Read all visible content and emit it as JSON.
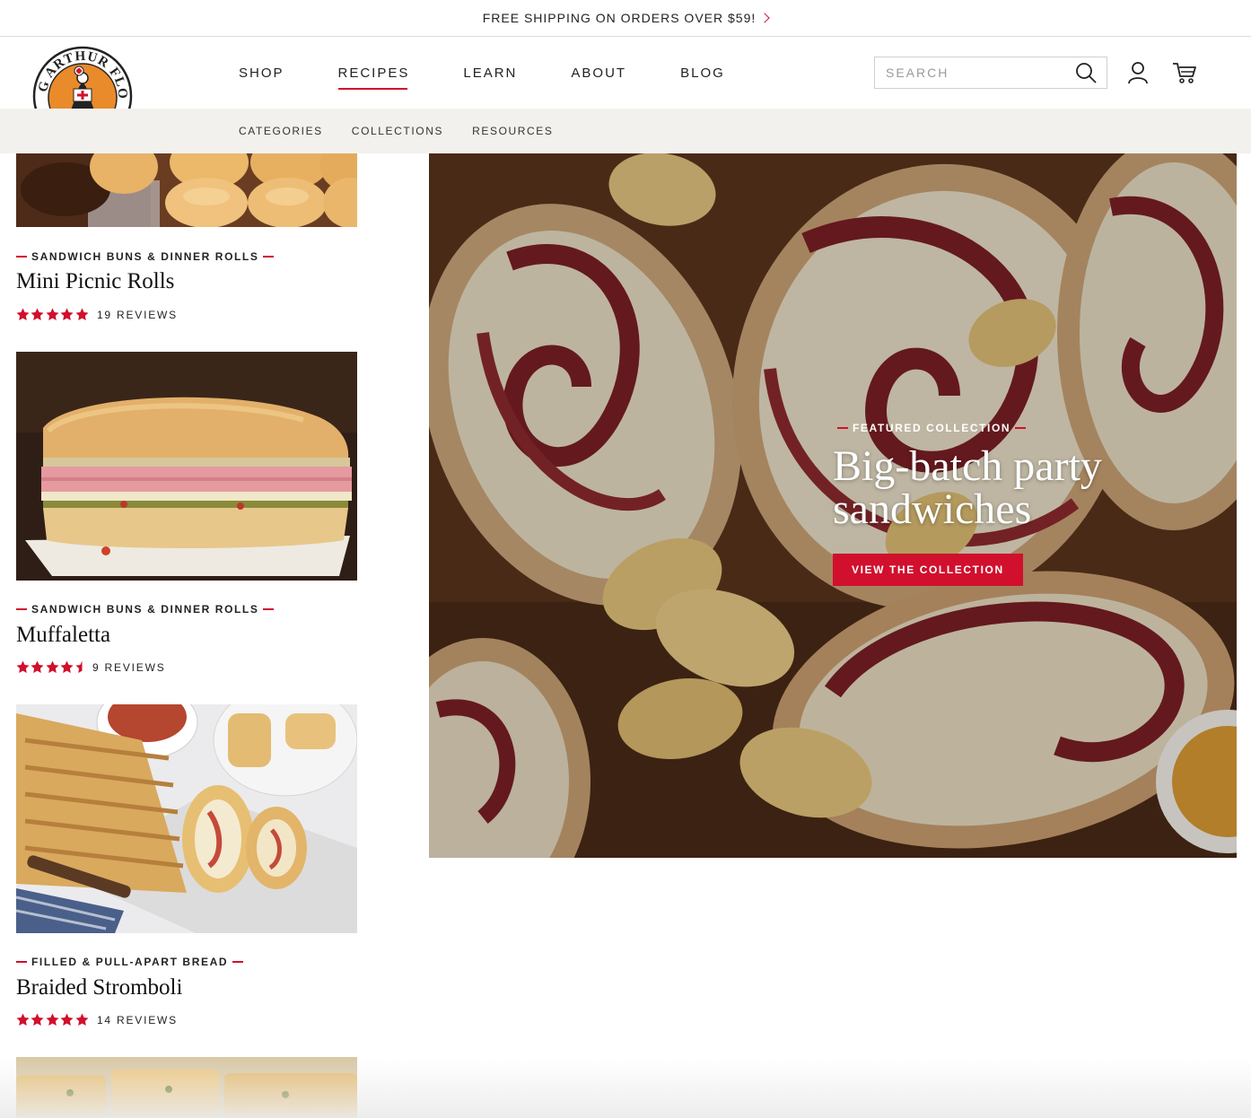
{
  "announcement": {
    "text": "FREE SHIPPING ON ORDERS OVER $59!"
  },
  "brand": {
    "logo_text": "KING ARTHUR FLOUR",
    "accent": "#d1102d"
  },
  "nav": {
    "items": [
      {
        "label": "SHOP",
        "active": false
      },
      {
        "label": "RECIPES",
        "active": true
      },
      {
        "label": "LEARN",
        "active": false
      },
      {
        "label": "ABOUT",
        "active": false
      },
      {
        "label": "BLOG",
        "active": false
      }
    ]
  },
  "search": {
    "placeholder": "SEARCH"
  },
  "subnav": {
    "items": [
      "CATEGORIES",
      "COLLECTIONS",
      "RESOURCES"
    ]
  },
  "cards": [
    {
      "category": "SANDWICH BUNS & DINNER ROLLS",
      "title": "Mini Picnic Rolls",
      "rating": 5,
      "reviews": "19 REVIEWS"
    },
    {
      "category": "SANDWICH BUNS & DINNER ROLLS",
      "title": "Muffaletta",
      "rating": 4.5,
      "reviews": "9 REVIEWS"
    },
    {
      "category": "FILLED & PULL-APART BREAD",
      "title": "Braided Stromboli",
      "rating": 5,
      "reviews": "14 REVIEWS"
    }
  ],
  "featured": {
    "label": "FEATURED COLLECTION",
    "title_line1": "Big-batch party",
    "title_line2": "sandwiches",
    "button": "VIEW THE COLLECTION"
  }
}
